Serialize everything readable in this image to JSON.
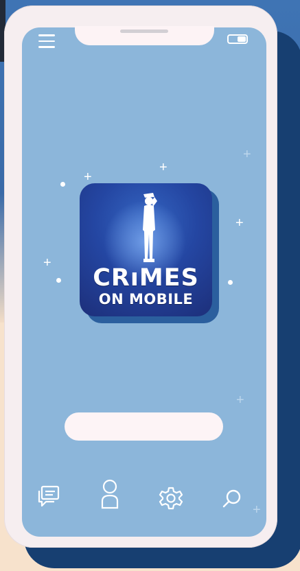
{
  "app": {
    "logo_line1": "CRıMES",
    "logo_line2": "ON MOBILE"
  },
  "colors": {
    "screen_bg": "#8cb6da",
    "phone_frame": "#f6eef0",
    "phone_shadow": "#173f71",
    "logo_blue": "#2446a2"
  },
  "icons": {
    "top_left": "menu-icon",
    "top_right": "battery-icon",
    "tab_bar": [
      "chat-icon",
      "user-icon",
      "settings-icon",
      "search-icon"
    ]
  }
}
